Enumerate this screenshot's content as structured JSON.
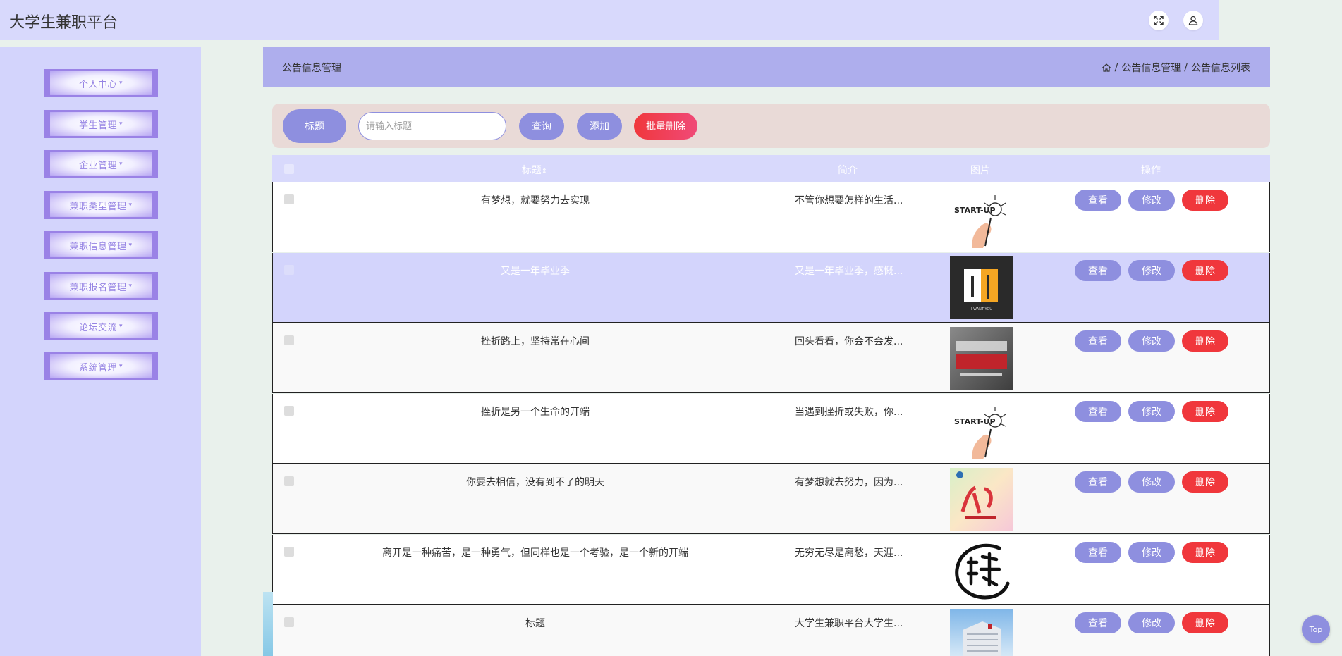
{
  "app": {
    "title": "大学生兼职平台"
  },
  "header": {
    "fullscreen_icon": "expand-icon",
    "user_icon": "user-icon"
  },
  "sidebar": {
    "items": [
      {
        "label": "个人中心"
      },
      {
        "label": "学生管理"
      },
      {
        "label": "企业管理"
      },
      {
        "label": "兼职类型管理"
      },
      {
        "label": "兼职信息管理"
      },
      {
        "label": "兼职报名管理"
      },
      {
        "label": "论坛交流"
      },
      {
        "label": "系统管理"
      }
    ]
  },
  "crumb": {
    "page_title": "公告信息管理",
    "home_icon": "home-icon",
    "path": [
      "公告信息管理",
      "公告信息列表"
    ]
  },
  "search": {
    "label": "标题",
    "placeholder": "请输入标题",
    "query_button": "查询",
    "add_button": "添加",
    "batch_delete_button": "批量删除"
  },
  "table": {
    "headers": {
      "title": "标题",
      "intro": "简介",
      "image": "图片",
      "actions": "操作"
    },
    "action_labels": {
      "view": "查看",
      "edit": "修改",
      "delete": "删除"
    },
    "rows": [
      {
        "title": "有梦想，就要努力去实现",
        "intro": "不管你想要怎样的生活...",
        "image": "startup-lightbulb"
      },
      {
        "title": "又是一年毕业季",
        "intro": "又是一年毕业季，感慨...",
        "image": "que-i-want-you"
      },
      {
        "title": "挫折路上，坚持常在心间",
        "intro": "回头看看，你会不会发...",
        "image": "dont-hesitate-poster"
      },
      {
        "title": "挫折是另一个生命的开端",
        "intro": "当遇到挫折或失败，你...",
        "image": "startup-lightbulb"
      },
      {
        "title": "你要去相信，没有到不了的明天",
        "intro": "有梦想就去努力，因为...",
        "image": "jiayou-poster"
      },
      {
        "title": "离开是一种痛苦，是一种勇气，但同样也是一个考验，是一个新的开端",
        "intro": "无穷无尽是离愁，天涯...",
        "image": "pin-calligraphy"
      },
      {
        "title": "标题",
        "intro": "大学生兼职平台大学生...",
        "image": "building-photo"
      }
    ]
  },
  "colors": {
    "accent": "#8e8fdf",
    "danger": "#f0373c",
    "header_bg": "#d8d9fc",
    "sidebar_bg": "#d3d4fc",
    "highlight_row": "#d3d4fc"
  },
  "back_to_top": "Top"
}
